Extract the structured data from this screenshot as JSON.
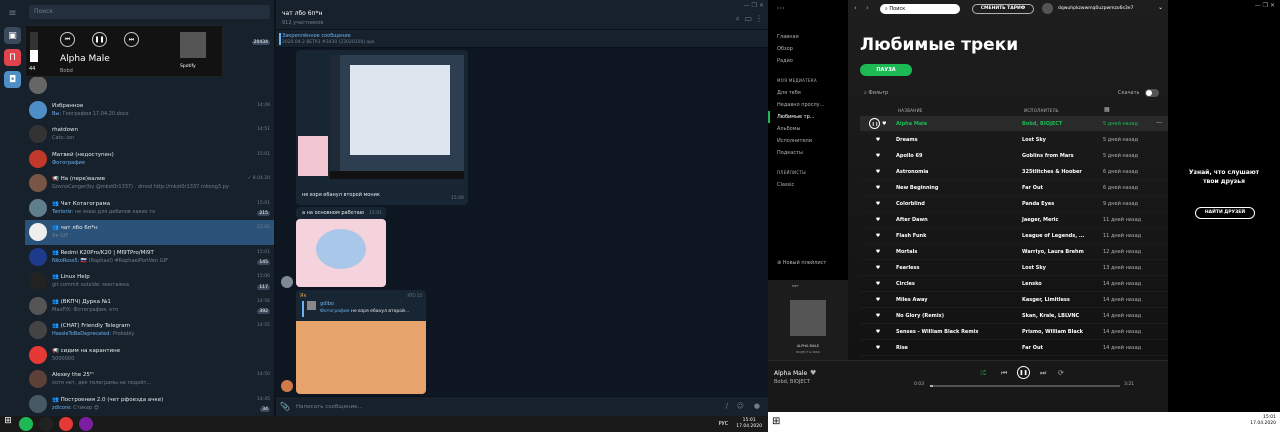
{
  "tg": {
    "search_placeholder": "Поиск",
    "rail_colors": [
      "#e0444a",
      "#4f8fc7"
    ],
    "chats": [
      {
        "name": "",
        "msg": "",
        "time": "",
        "badge": "20434",
        "avc": "#444"
      },
      {
        "name": "",
        "msg": "",
        "time": "",
        "badge": "",
        "avc": "#555"
      },
      {
        "name": "",
        "msg": "",
        "time": "",
        "badge": "",
        "avc": "#666"
      },
      {
        "name": "Избранное",
        "msg_hl": "Вы: ",
        "msg": "География 17.04.20.docx",
        "time": "14:49",
        "badge": "",
        "avc": "#4f8fc7"
      },
      {
        "name": "rhatdown",
        "msg": "Cats:.ion",
        "time": "14:51",
        "badge": "",
        "avc": "#333"
      },
      {
        "name": "Матвей (недоступен)",
        "msg_hl": "Фотография",
        "msg": "",
        "time": "15:01",
        "badge": "",
        "avc": "#c0392b"
      },
      {
        "name": "📢 На (пере)валив",
        "msg": "GovnoCanger(by @mkst0r1337) . dmod http://mkst0r1337.mkong3.py",
        "time": "✓ 8.04.20",
        "badge": "",
        "avc": "#795548"
      },
      {
        "name": "👥 Чат Котагограма",
        "msg_hl": "Tentoriz: ",
        "msg": "не знаю для дебилов каких то",
        "time": "15:01",
        "badge": "215",
        "avc": "#607d8b"
      },
      {
        "name": "👥 чат лбо 6п*н",
        "msg": "Як GIF",
        "time": "15:01",
        "badge": "",
        "avc": "#eee",
        "active": true
      },
      {
        "name": "👥 Redmi K20Pro/K20 | MI9TPro/MI9T",
        "msg_hl": "NikoRoss5: ",
        "msg": "🇷🇺 (Raphael) #RaphaelPortVen GIF",
        "time": "15:01",
        "badge": "145",
        "avc": "#1e3a8a"
      },
      {
        "name": "👥 Linux Help",
        "msg": "git commit outside: монтажка",
        "time": "15:00",
        "badge": "117",
        "avc": "#222"
      },
      {
        "name": "👥 (ВКПЧ) Дурка №1",
        "msg": "MaxFIX: Фотография, кто",
        "time": "14:56",
        "badge": "392",
        "avc": "#555"
      },
      {
        "name": "👥 (CHAT) Friendly Telegram",
        "msg_hl": "HassleToBeDeprecated: ",
        "msg": "Probably",
        "time": "14:55",
        "badge": "",
        "avc": "#444"
      },
      {
        "name": "📢 сидим на карантине",
        "msg": "5000000",
        "time": "",
        "badge": "",
        "avc": "#e53935"
      },
      {
        "name": "Alexey the 25ᵗʰ",
        "msg": "хотя нет, дек телеграмы не подойт...",
        "time": "14:50",
        "badge": "",
        "avc": "#5d4037"
      },
      {
        "name": "👥 Построения 2.0 (чет рфоезда ачке)",
        "msg_hl": "zdicore: ",
        "msg": "Стикер 😍",
        "time": "14:45",
        "badge": "34",
        "avc": "#455a64"
      },
      {
        "name": "👥 Srv Channel",
        "msg": "",
        "time": "14:41",
        "badge": "",
        "avc": "#333"
      }
    ],
    "mini_player": {
      "title": "Alpha Male",
      "artist": "Bobd",
      "vol": "44",
      "spotify": "Spotify"
    },
    "chat_title": "чат лбо 6п*н",
    "chat_sub": "912 участников",
    "pinned_title": "Закреплённое сообщение",
    "pinned_text": "2020.04.2 BETA1 #3430 (23020200).apk",
    "msg1": "не взря ебанул второй моник",
    "msg1_time": "15:00",
    "msg2": "а на основном работаю",
    "msg2_time": "15:01",
    "reply_name": "Як",
    "reply_from": "gdlbo",
    "reply_from_msg": "не взря ебанул второй...",
    "reply_hl": "Фотография",
    "reply_time": "ЯТО 15",
    "input_placeholder": "Написать сообщение...",
    "clock": "15:01",
    "date": "17.04.2020",
    "lang": "РУС"
  },
  "sp": {
    "search": "Поиск",
    "upgrade": "СМЕНИТЬ ТАРИФ",
    "user": "dqwuhpkzwwmq0uzpwmzo6s3e7",
    "nav": [
      "Главная",
      "Обзор",
      "Радио"
    ],
    "lib_hdr": "МОЯ МЕДИАТЕКА",
    "lib": [
      "Для тебя",
      "Недавно прослу...",
      "Любимые тр...",
      "Альбомы",
      "Исполнители",
      "Подкасты"
    ],
    "pl_hdr": "ПЛЕЙЛИСТЫ",
    "pl": [
      "Classic"
    ],
    "new_pl": "Новый плейлист",
    "title": "Любимые треки",
    "play": "ПАУЗА",
    "filter": "Фильтр",
    "download": "Скачать",
    "col_name": "НАЗВАНИЕ",
    "col_artist": "ИСПОЛНИТЕЛЬ",
    "tracks": [
      [
        "Alpha Male",
        "Bobd, BIOJECT",
        "5 дней назад"
      ],
      [
        "Dreams",
        "Lost Sky",
        "5 дней назад"
      ],
      [
        "Apollo 69",
        "Goblins from Mars",
        "5 дней назад"
      ],
      [
        "Astronomia",
        "325tlitches & Hoober",
        "6 дней назад"
      ],
      [
        "New Beginning",
        "Far Out",
        "6 дней назад"
      ],
      [
        "Colorblind",
        "Panda Eyes",
        "9 дней назад"
      ],
      [
        "After Dawn",
        "Jaeger, Meric",
        "11 дней назад"
      ],
      [
        "Flash Funk",
        "League of Legends, ...",
        "11 дней назад"
      ],
      [
        "Mortals",
        "Warriyo, Laura Brehm",
        "12 дней назад"
      ],
      [
        "Fearless",
        "Lost Sky",
        "13 дней назад"
      ],
      [
        "Circles",
        "Lensko",
        "14 дней назад"
      ],
      [
        "Miles Away",
        "Kasger, Limitless",
        "14 дней назад"
      ],
      [
        "No Glory (Remix)",
        "Skan, Krale, LBLVNC",
        "14 дней назад"
      ],
      [
        "Senses - William Black Remix",
        "Prismo, William Black",
        "14 дней назад"
      ],
      [
        "Rise",
        "Far Out",
        "14 дней назад"
      ]
    ],
    "now_title": "Alpha Male",
    "now_artist": "Bobd, BIOJECT",
    "time_cur": "0:03",
    "time_total": "3:21",
    "cover_label": "ALPHA MALE",
    "cover_sub": "BIOJECT & ЯЖК",
    "friends_title": "Узнай, что слушают твои друзья",
    "friends_btn": "НАЙТИ ДРУЗЕЙ",
    "green": "#1db954",
    "clock": "15:01",
    "date": "17.04.2020",
    "progress": 0.015
  }
}
